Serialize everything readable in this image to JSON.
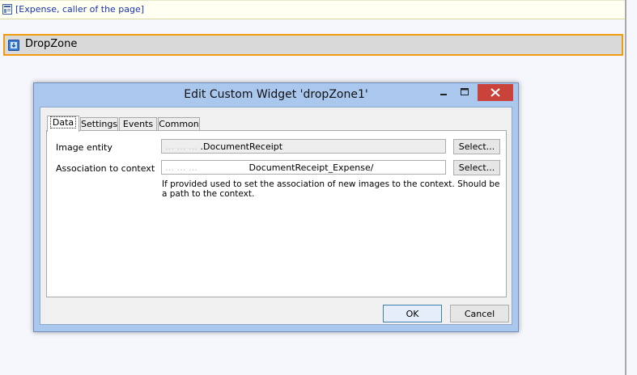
{
  "caller": {
    "link_text": "[Expense, caller of the page]"
  },
  "dropzone": {
    "label": "DropZone"
  },
  "dialog": {
    "title": "Edit Custom Widget 'dropZone1'",
    "tabs": [
      "Data",
      "Settings",
      "Events",
      "Common"
    ],
    "active_tab": "Data",
    "fields": [
      {
        "label": "Image entity",
        "value_hidden": "… … …",
        "value_visible": ".DocumentReceipt",
        "button": "Select..."
      },
      {
        "label": "Association to context",
        "value_hidden": "… … …",
        "value_visible": "DocumentReceipt_Expense/",
        "button": "Select..."
      }
    ],
    "hint": "If provided used to set the association of new images to the context. Should be a path to the context.",
    "ok_label": "OK",
    "cancel_label": "Cancel"
  },
  "colors": {
    "dropzone_border": "#f29b0e",
    "dialog_frame": "#aac8ee",
    "close_button": "#c9433a",
    "link": "#1a34b0"
  }
}
